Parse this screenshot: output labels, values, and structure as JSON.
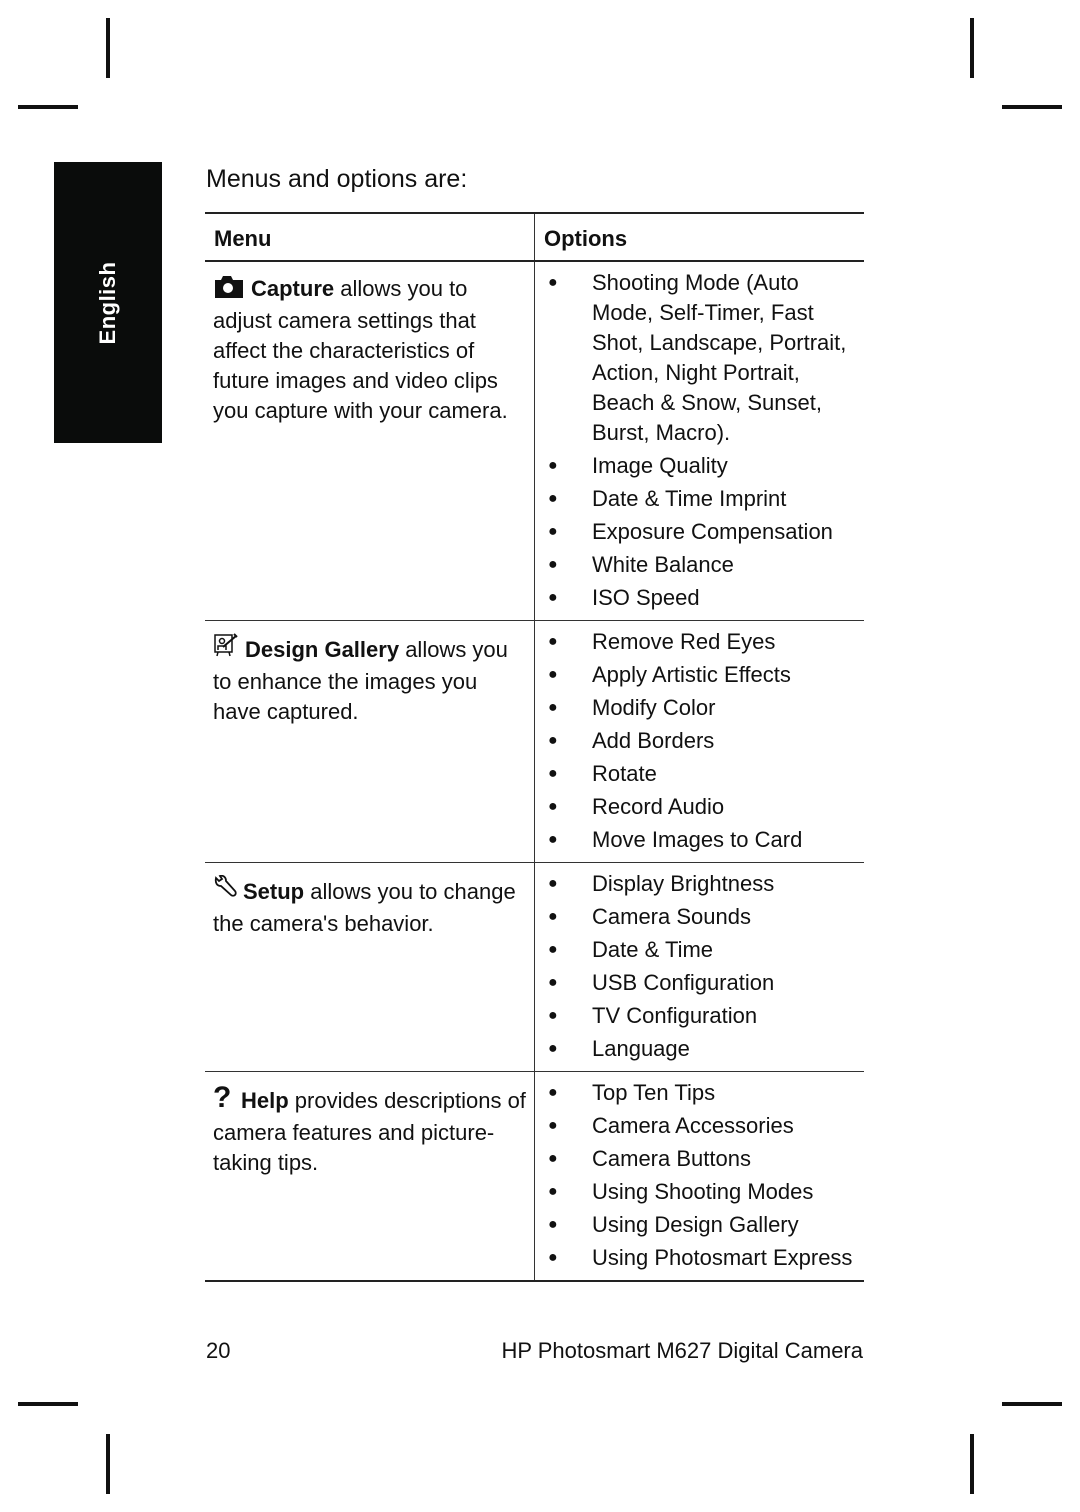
{
  "side_tab": {
    "label": "English"
  },
  "intro": "Menus and options are:",
  "table": {
    "headers": {
      "menu": "Menu",
      "options": "Options"
    },
    "rows": [
      {
        "icon": "camera-icon",
        "menu_name": "Capture",
        "menu_desc": " allows you to adjust camera settings that affect the characteristics of future images and video clips you capture with your camera.",
        "options": [
          "Shooting Mode (Auto Mode, Self-Timer, Fast Shot, Landscape, Portrait, Action, Night Portrait, Beach & Snow, Sunset, Burst, Macro).",
          "Image Quality",
          "Date & Time Imprint",
          "Exposure Compensation",
          "White Balance",
          "ISO Speed"
        ]
      },
      {
        "icon": "design-gallery-icon",
        "menu_name": "Design Gallery",
        "menu_desc": " allows you to enhance the images you have captured.",
        "options": [
          "Remove Red Eyes",
          "Apply Artistic Effects",
          "Modify Color",
          "Add Borders",
          "Rotate",
          "Record Audio",
          "Move Images to Card"
        ]
      },
      {
        "icon": "wrench-icon",
        "menu_name": "Setup",
        "menu_desc": " allows you to change the camera's behavior.",
        "options": [
          "Display Brightness",
          "Camera Sounds",
          "Date & Time",
          "USB Configuration",
          "TV Configuration",
          "Language"
        ]
      },
      {
        "icon": "help-icon",
        "menu_name": "Help",
        "menu_desc": " provides descriptions of camera features and picture-taking tips.",
        "options": [
          "Top Ten Tips",
          "Camera Accessories",
          "Camera Buttons",
          "Using Shooting Modes",
          "Using Design Gallery",
          "Using Photosmart Express"
        ]
      }
    ]
  },
  "bullet_glyph": "●",
  "footer": {
    "page_number": "20",
    "title": "HP Photosmart M627 Digital Camera"
  }
}
